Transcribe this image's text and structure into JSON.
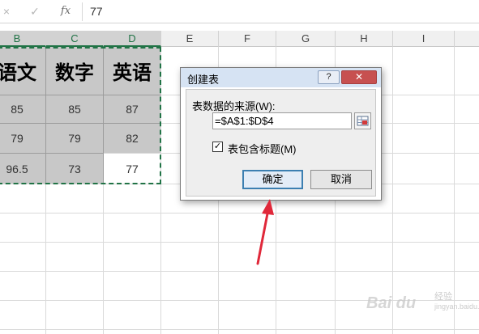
{
  "formula_bar": {
    "cancel_icon": "×",
    "enter_icon": "✓",
    "fx_label": "fx",
    "value": "77"
  },
  "columns": [
    "B",
    "C",
    "D",
    "E",
    "F",
    "G",
    "H",
    "I"
  ],
  "selected_columns": [
    "B",
    "C",
    "D"
  ],
  "table": {
    "headers": [
      "语文",
      "数字",
      "英语"
    ],
    "rows": [
      [
        "85",
        "85",
        "87"
      ],
      [
        "79",
        "79",
        "82"
      ],
      [
        "96.5",
        "73",
        "77"
      ]
    ]
  },
  "dialog": {
    "title": "创建表",
    "help_label": "?",
    "close_label": "✕",
    "source_label": "表数据的来源(W):",
    "source_value": "=$A$1:$D$4",
    "checkbox_checked": true,
    "checkbox_mark": "✓",
    "checkbox_label": "表包含标题(M)",
    "ok_label": "确定",
    "cancel_label": "取消"
  },
  "colors": {
    "accent": "#217346",
    "selection_fill": "#c8c8c8",
    "arrow": "#e0283a",
    "dialog_title_bar": "#d6e3f3"
  }
}
